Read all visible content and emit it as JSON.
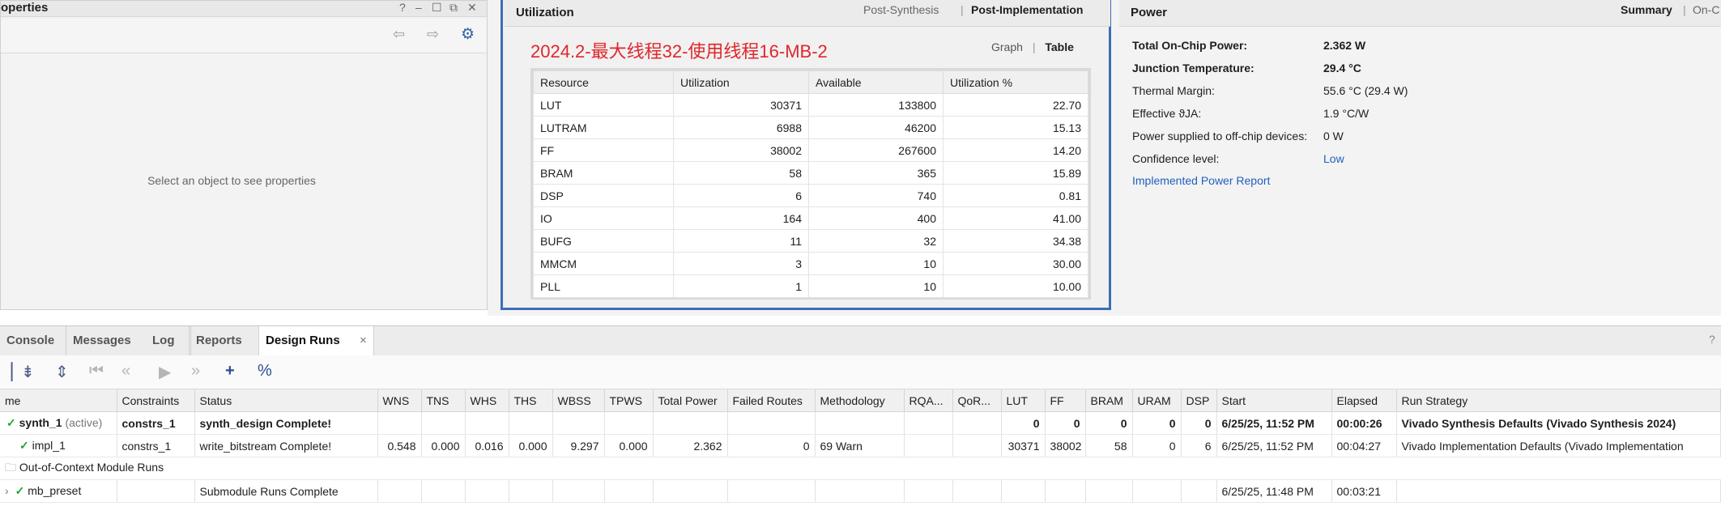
{
  "properties": {
    "title": "operties",
    "controls": [
      "?",
      "–",
      "☐",
      "⧉",
      "✕"
    ],
    "empty_text": "Select an object to see properties"
  },
  "utilization": {
    "title": "Utilization",
    "tab_post_synthesis": "Post-Synthesis",
    "tab_post_impl": "Post-Implementation",
    "big_title": "2024.2-最大线程32-使用线程16-MB-2",
    "view_graph": "Graph",
    "view_table": "Table",
    "headers": [
      "Resource",
      "Utilization",
      "Available",
      "Utilization %"
    ],
    "rows": [
      [
        "LUT",
        "30371",
        "133800",
        "22.70"
      ],
      [
        "LUTRAM",
        "6988",
        "46200",
        "15.13"
      ],
      [
        "FF",
        "38002",
        "267600",
        "14.20"
      ],
      [
        "BRAM",
        "58",
        "365",
        "15.89"
      ],
      [
        "DSP",
        "6",
        "740",
        "0.81"
      ],
      [
        "IO",
        "164",
        "400",
        "41.00"
      ],
      [
        "BUFG",
        "11",
        "32",
        "34.38"
      ],
      [
        "MMCM",
        "3",
        "10",
        "30.00"
      ],
      [
        "PLL",
        "1",
        "10",
        "10.00"
      ]
    ]
  },
  "power": {
    "title": "Power",
    "tab_summary": "Summary",
    "tab_onchip": "On-C",
    "rows": [
      {
        "label": "Total On-Chip Power:",
        "value": "2.362 W",
        "bold": true
      },
      {
        "label": "Junction Temperature:",
        "value": "29.4 °C",
        "bold": true
      },
      {
        "label": "Thermal Margin:",
        "value": "55.6 °C (29.4 W)",
        "bold": false
      },
      {
        "label": "Effective ϑJA:",
        "value": "1.9 °C/W",
        "bold": false
      },
      {
        "label": "Power supplied to off-chip devices:",
        "value": "0 W",
        "bold": false
      },
      {
        "label": "Confidence level:",
        "value": "Low",
        "bold": false,
        "link": true
      }
    ],
    "report_link": "Implemented Power Report"
  },
  "bottom_tabs": [
    "Console",
    "Messages",
    "Log",
    "Reports",
    "Design Runs"
  ],
  "active_tab": "Design Runs",
  "runs": {
    "headers": [
      "me",
      "Constraints",
      "Status",
      "WNS",
      "TNS",
      "WHS",
      "THS",
      "WBSS",
      "TPWS",
      "Total Power",
      "Failed Routes",
      "Methodology",
      "RQA...",
      "QoR...",
      "LUT",
      "FF",
      "BRAM",
      "URAM",
      "DSP",
      "Start",
      "Elapsed",
      "Run Strategy"
    ],
    "synth": {
      "name": "synth_1",
      "tag": "(active)",
      "constraints": "constrs_1",
      "status": "synth_design Complete!",
      "lut": "0",
      "ff": "0",
      "bram": "0",
      "uram": "0",
      "dsp": "0",
      "start": "6/25/25, 11:52 PM",
      "elapsed": "00:00:26",
      "strategy": "Vivado Synthesis Defaults (Vivado Synthesis 2024)"
    },
    "impl": {
      "name": "impl_1",
      "constraints": "constrs_1",
      "status": "write_bitstream Complete!",
      "wns": "0.548",
      "tns": "0.000",
      "whs": "0.016",
      "ths": "0.000",
      "wbss": "9.297",
      "tpws": "0.000",
      "power": "2.362",
      "failed": "0",
      "methodology": "69 Warn",
      "lut": "30371",
      "ff": "38002",
      "bram": "58",
      "uram": "0",
      "dsp": "6",
      "start": "6/25/25, 11:52 PM",
      "elapsed": "00:04:27",
      "strategy": "Vivado Implementation Defaults (Vivado Implementation"
    },
    "ooc_label": "Out-of-Context Module Runs",
    "preset": {
      "name": "mb_preset",
      "status": "Submodule Runs Complete",
      "start": "6/25/25, 11:48 PM",
      "elapsed": "00:03:21"
    }
  }
}
